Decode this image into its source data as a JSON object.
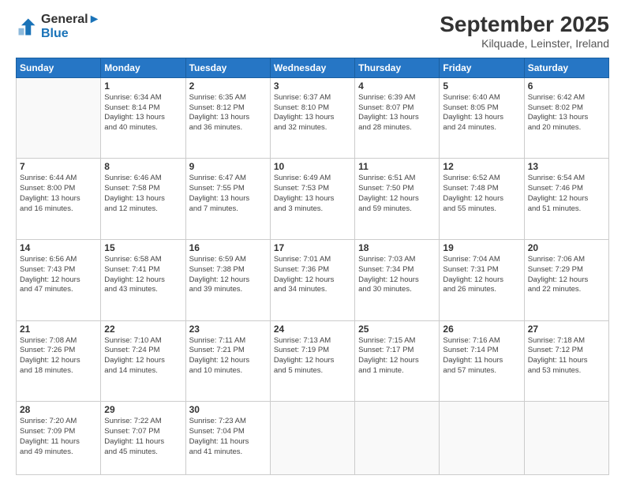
{
  "logo": {
    "line1": "General",
    "line2": "Blue"
  },
  "title": "September 2025",
  "subtitle": "Kilquade, Leinster, Ireland",
  "days_of_week": [
    "Sunday",
    "Monday",
    "Tuesday",
    "Wednesday",
    "Thursday",
    "Friday",
    "Saturday"
  ],
  "weeks": [
    [
      {
        "day": "",
        "info": ""
      },
      {
        "day": "1",
        "info": "Sunrise: 6:34 AM\nSunset: 8:14 PM\nDaylight: 13 hours\nand 40 minutes."
      },
      {
        "day": "2",
        "info": "Sunrise: 6:35 AM\nSunset: 8:12 PM\nDaylight: 13 hours\nand 36 minutes."
      },
      {
        "day": "3",
        "info": "Sunrise: 6:37 AM\nSunset: 8:10 PM\nDaylight: 13 hours\nand 32 minutes."
      },
      {
        "day": "4",
        "info": "Sunrise: 6:39 AM\nSunset: 8:07 PM\nDaylight: 13 hours\nand 28 minutes."
      },
      {
        "day": "5",
        "info": "Sunrise: 6:40 AM\nSunset: 8:05 PM\nDaylight: 13 hours\nand 24 minutes."
      },
      {
        "day": "6",
        "info": "Sunrise: 6:42 AM\nSunset: 8:02 PM\nDaylight: 13 hours\nand 20 minutes."
      }
    ],
    [
      {
        "day": "7",
        "info": "Sunrise: 6:44 AM\nSunset: 8:00 PM\nDaylight: 13 hours\nand 16 minutes."
      },
      {
        "day": "8",
        "info": "Sunrise: 6:46 AM\nSunset: 7:58 PM\nDaylight: 13 hours\nand 12 minutes."
      },
      {
        "day": "9",
        "info": "Sunrise: 6:47 AM\nSunset: 7:55 PM\nDaylight: 13 hours\nand 7 minutes."
      },
      {
        "day": "10",
        "info": "Sunrise: 6:49 AM\nSunset: 7:53 PM\nDaylight: 13 hours\nand 3 minutes."
      },
      {
        "day": "11",
        "info": "Sunrise: 6:51 AM\nSunset: 7:50 PM\nDaylight: 12 hours\nand 59 minutes."
      },
      {
        "day": "12",
        "info": "Sunrise: 6:52 AM\nSunset: 7:48 PM\nDaylight: 12 hours\nand 55 minutes."
      },
      {
        "day": "13",
        "info": "Sunrise: 6:54 AM\nSunset: 7:46 PM\nDaylight: 12 hours\nand 51 minutes."
      }
    ],
    [
      {
        "day": "14",
        "info": "Sunrise: 6:56 AM\nSunset: 7:43 PM\nDaylight: 12 hours\nand 47 minutes."
      },
      {
        "day": "15",
        "info": "Sunrise: 6:58 AM\nSunset: 7:41 PM\nDaylight: 12 hours\nand 43 minutes."
      },
      {
        "day": "16",
        "info": "Sunrise: 6:59 AM\nSunset: 7:38 PM\nDaylight: 12 hours\nand 39 minutes."
      },
      {
        "day": "17",
        "info": "Sunrise: 7:01 AM\nSunset: 7:36 PM\nDaylight: 12 hours\nand 34 minutes."
      },
      {
        "day": "18",
        "info": "Sunrise: 7:03 AM\nSunset: 7:34 PM\nDaylight: 12 hours\nand 30 minutes."
      },
      {
        "day": "19",
        "info": "Sunrise: 7:04 AM\nSunset: 7:31 PM\nDaylight: 12 hours\nand 26 minutes."
      },
      {
        "day": "20",
        "info": "Sunrise: 7:06 AM\nSunset: 7:29 PM\nDaylight: 12 hours\nand 22 minutes."
      }
    ],
    [
      {
        "day": "21",
        "info": "Sunrise: 7:08 AM\nSunset: 7:26 PM\nDaylight: 12 hours\nand 18 minutes."
      },
      {
        "day": "22",
        "info": "Sunrise: 7:10 AM\nSunset: 7:24 PM\nDaylight: 12 hours\nand 14 minutes."
      },
      {
        "day": "23",
        "info": "Sunrise: 7:11 AM\nSunset: 7:21 PM\nDaylight: 12 hours\nand 10 minutes."
      },
      {
        "day": "24",
        "info": "Sunrise: 7:13 AM\nSunset: 7:19 PM\nDaylight: 12 hours\nand 5 minutes."
      },
      {
        "day": "25",
        "info": "Sunrise: 7:15 AM\nSunset: 7:17 PM\nDaylight: 12 hours\nand 1 minute."
      },
      {
        "day": "26",
        "info": "Sunrise: 7:16 AM\nSunset: 7:14 PM\nDaylight: 11 hours\nand 57 minutes."
      },
      {
        "day": "27",
        "info": "Sunrise: 7:18 AM\nSunset: 7:12 PM\nDaylight: 11 hours\nand 53 minutes."
      }
    ],
    [
      {
        "day": "28",
        "info": "Sunrise: 7:20 AM\nSunset: 7:09 PM\nDaylight: 11 hours\nand 49 minutes."
      },
      {
        "day": "29",
        "info": "Sunrise: 7:22 AM\nSunset: 7:07 PM\nDaylight: 11 hours\nand 45 minutes."
      },
      {
        "day": "30",
        "info": "Sunrise: 7:23 AM\nSunset: 7:04 PM\nDaylight: 11 hours\nand 41 minutes."
      },
      {
        "day": "",
        "info": ""
      },
      {
        "day": "",
        "info": ""
      },
      {
        "day": "",
        "info": ""
      },
      {
        "day": "",
        "info": ""
      }
    ]
  ]
}
